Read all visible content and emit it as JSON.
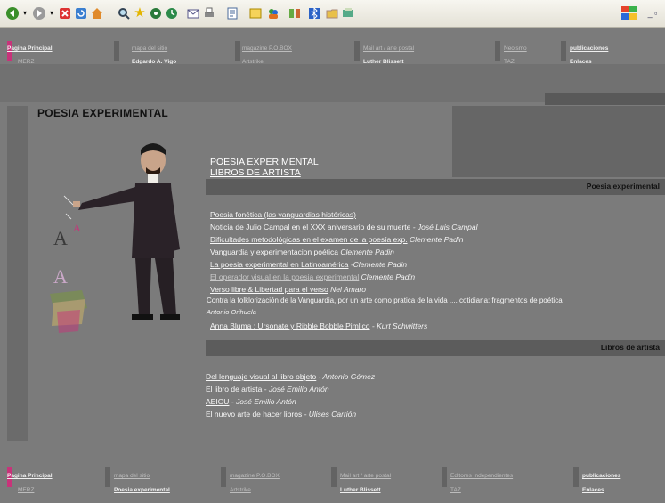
{
  "toolbar": {
    "icons": [
      "back-icon",
      "forward-icon",
      "stop-icon",
      "refresh-icon",
      "home-icon",
      "search-icon",
      "favorites-icon",
      "media-icon",
      "history-icon",
      "mail-icon",
      "print-icon",
      "edit-icon",
      "discuss-icon",
      "messenger-icon",
      "research-icon",
      "bluetooth-icon",
      "folder-icon",
      "translate-icon",
      "windows-logo"
    ],
    "window_controls": "_ ▫"
  },
  "header_nav": {
    "row1": [
      {
        "label": "Pagina Principal"
      },
      {
        "label": "mapa del sitio"
      },
      {
        "label": "magazine P.O.BOX"
      },
      {
        "label": "Mail art / arte postal"
      },
      {
        "label": "Neoismo"
      },
      {
        "label": "publicaciones"
      }
    ],
    "row2": [
      {
        "label": "MERZ"
      },
      {
        "label": "Edgardo A. Vigo"
      },
      {
        "label": "Artstrike"
      },
      {
        "label": "Luther Blissett"
      },
      {
        "label": "TAZ"
      },
      {
        "label": "Enlaces"
      }
    ]
  },
  "page_title": "POESIA  EXPERIMENTAL",
  "hero_links": [
    "POESIA EXPERIMENTAL",
    "LIBROS DE ARTISTA"
  ],
  "section1": {
    "title": "Poesia experimental",
    "items": [
      {
        "link": "Poesia fonética (las vanguardias históricas)",
        "author": ""
      },
      {
        "link": "Noticia de Julio Campal en el XXX aniversario de su muerte",
        "author": " - José Luis Campal"
      },
      {
        "link": "Dificultades metodológicas en el examen de la poesía exp.",
        "author": " Clemente Padin"
      },
      {
        "link": "Vanguardia y experimentacion poética",
        "author": " Clemente Padin"
      },
      {
        "link": "La poesia experimental en Latinoamérica",
        "author": " -Clemente Padin"
      },
      {
        "link": "El operador visual en la poesia experimental",
        "author": " Clemente Padin"
      },
      {
        "link": "Verso libre & Libertad para el verso",
        "author": " Nel Amaro"
      },
      {
        "link": "Contra la folklorización de la Vanguardia, por un arte como pratica de la vida .... cotidiana: fragmentos de poética",
        "author": ""
      },
      {
        "link": "",
        "author": "Antonio Orihuela"
      },
      {
        "link": "Anna Bluma ; Ursonate y Ribble Bobble Pimlico",
        "author": " - Kurt Schwitters"
      }
    ]
  },
  "section2": {
    "title": "Libros de artista",
    "items": [
      {
        "link": "Del lenguaje visual al libro objeto",
        "author": " -  Antonio Gómez"
      },
      {
        "link": "El libro de artista",
        "author": " -  José Emilio Antón"
      },
      {
        "link": "AEIOU",
        "author": " - José Emilio Antón"
      },
      {
        "link": "El nuevo arte de hacer libros",
        "author": " - Ulises Carrión"
      }
    ]
  },
  "footer_nav": {
    "row1": [
      {
        "label": "Pagina Principal"
      },
      {
        "label": "mapa del sitio"
      },
      {
        "label": "magazine P.O.BOX"
      },
      {
        "label": "Mail art / arte postal"
      },
      {
        "label": "Editores Independientes"
      },
      {
        "label": "publicaciones"
      }
    ],
    "row2": [
      {
        "label": "MERZ"
      },
      {
        "label": "Poesia experimental"
      },
      {
        "label": "Artstrike"
      },
      {
        "label": "Luther Blissett"
      },
      {
        "label": "TAZ"
      },
      {
        "label": "Enlaces"
      }
    ]
  },
  "colors": {
    "accent_pink": "#c8337a",
    "nav_bar": "#636363",
    "page_bg": "#7b7b7b"
  }
}
